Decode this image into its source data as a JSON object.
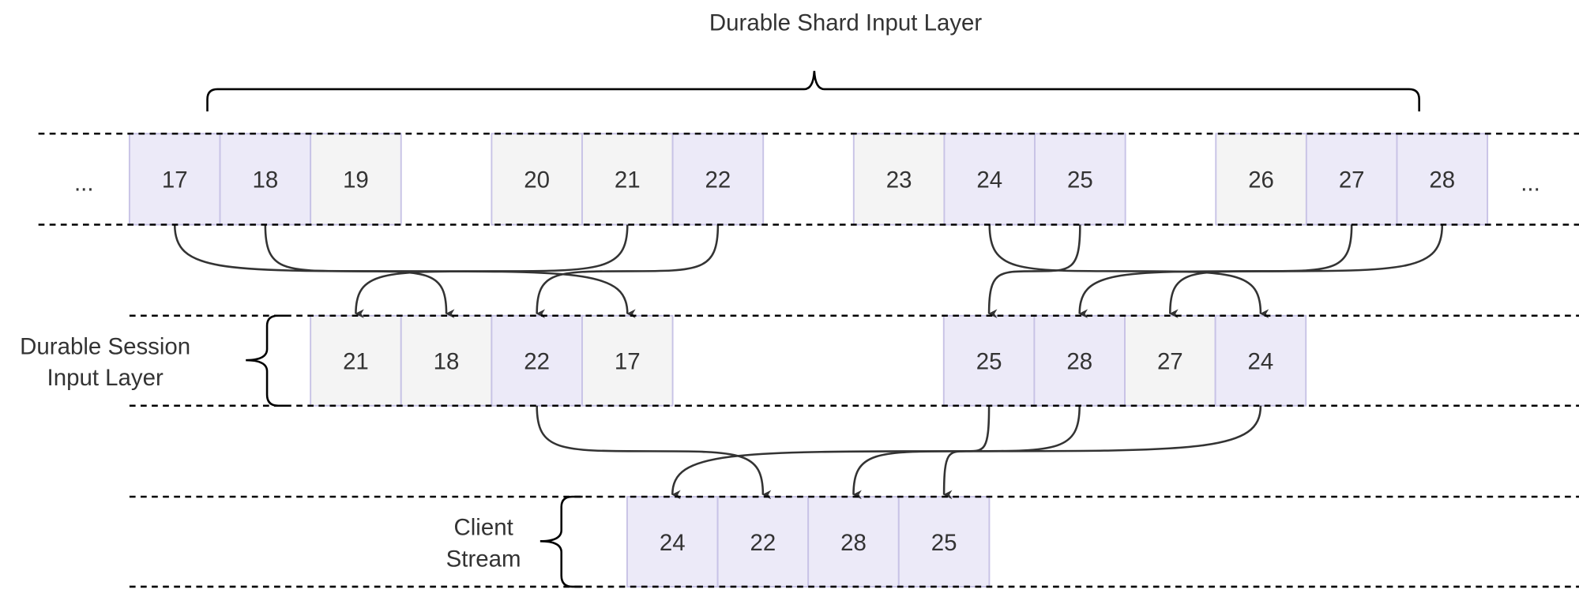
{
  "colors": {
    "highlight_fill": "#ECEAF8",
    "plain_fill": "#F4F4F4",
    "cell_border": "#C8C3E6",
    "text": "#333333",
    "arrow": "#333333"
  },
  "shard_layer": {
    "title": "Durable Shard Input Layer",
    "ellipsis_left": "...",
    "ellipsis_right": "...",
    "groups": [
      [
        {
          "value": "17",
          "hl": true
        },
        {
          "value": "18",
          "hl": true
        },
        {
          "value": "19",
          "hl": false
        }
      ],
      [
        {
          "value": "20",
          "hl": false
        },
        {
          "value": "21",
          "hl": false
        },
        {
          "value": "22",
          "hl": true
        }
      ],
      [
        {
          "value": "23",
          "hl": false
        },
        {
          "value": "24",
          "hl": true
        },
        {
          "value": "25",
          "hl": true
        }
      ],
      [
        {
          "value": "26",
          "hl": false
        },
        {
          "value": "27",
          "hl": true
        },
        {
          "value": "28",
          "hl": true
        }
      ]
    ]
  },
  "session_layer": {
    "title_line1": "Durable Session",
    "title_line2": "Input Layer",
    "groups": [
      [
        {
          "value": "21",
          "hl": false
        },
        {
          "value": "18",
          "hl": false
        },
        {
          "value": "22",
          "hl": true
        },
        {
          "value": "17",
          "hl": false
        }
      ],
      [
        {
          "value": "25",
          "hl": true
        },
        {
          "value": "28",
          "hl": true
        },
        {
          "value": "27",
          "hl": false
        },
        {
          "value": "24",
          "hl": true
        }
      ]
    ]
  },
  "client_stream": {
    "title_line1": "Client",
    "title_line2": "Stream",
    "cells": [
      {
        "value": "24",
        "hl": true
      },
      {
        "value": "22",
        "hl": true
      },
      {
        "value": "28",
        "hl": true
      },
      {
        "value": "25",
        "hl": true
      }
    ]
  },
  "flows_shard_to_session": [
    {
      "from": "17",
      "to": "17"
    },
    {
      "from": "18",
      "to": "18"
    },
    {
      "from": "21",
      "to": "21"
    },
    {
      "from": "22",
      "to": "22"
    },
    {
      "from": "24",
      "to": "24"
    },
    {
      "from": "25",
      "to": "25"
    },
    {
      "from": "27",
      "to": "27"
    },
    {
      "from": "28",
      "to": "28"
    }
  ],
  "flows_session_to_client": [
    {
      "from": "22",
      "to": "22"
    },
    {
      "from": "25",
      "to": "25"
    },
    {
      "from": "28",
      "to": "28"
    },
    {
      "from": "24",
      "to": "24"
    }
  ]
}
